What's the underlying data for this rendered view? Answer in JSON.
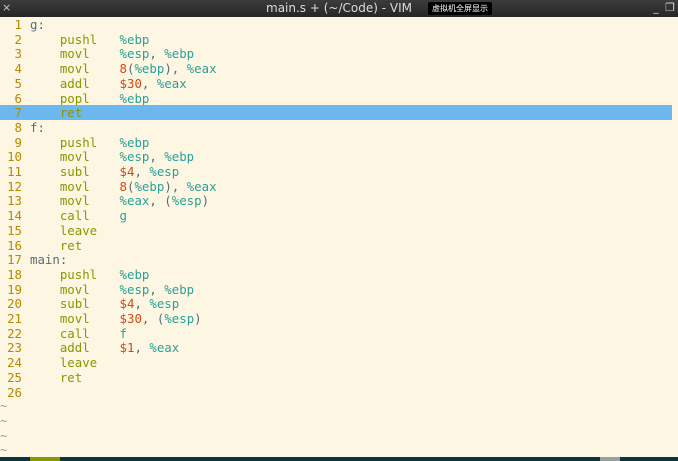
{
  "window": {
    "title": "main.s + (~/Code) - VIM",
    "badge": "虚拟机全屏显示",
    "close_glyph": "×",
    "minimize_glyph": "_",
    "restore_glyph": "❐"
  },
  "editor": {
    "highlighted_line": 7,
    "lines": [
      {
        "n": "1",
        "label": "g:",
        "ins": "",
        "ops": []
      },
      {
        "n": "2",
        "label": "",
        "ins": "pushl",
        "ops": [
          {
            "t": "reg",
            "v": "%ebp"
          }
        ]
      },
      {
        "n": "3",
        "label": "",
        "ins": "movl",
        "ops": [
          {
            "t": "reg",
            "v": "%esp"
          },
          {
            "t": "p",
            "v": ", "
          },
          {
            "t": "reg",
            "v": "%ebp"
          }
        ]
      },
      {
        "n": "4",
        "label": "",
        "ins": "movl",
        "ops": [
          {
            "t": "num",
            "v": "8"
          },
          {
            "t": "p",
            "v": "("
          },
          {
            "t": "reg",
            "v": "%ebp"
          },
          {
            "t": "p",
            "v": "), "
          },
          {
            "t": "reg",
            "v": "%eax"
          }
        ]
      },
      {
        "n": "5",
        "label": "",
        "ins": "addl",
        "ops": [
          {
            "t": "num",
            "v": "$30"
          },
          {
            "t": "p",
            "v": ", "
          },
          {
            "t": "reg",
            "v": "%eax"
          }
        ]
      },
      {
        "n": "6",
        "label": "",
        "ins": "popl",
        "ops": [
          {
            "t": "reg",
            "v": "%ebp"
          }
        ]
      },
      {
        "n": "7",
        "label": "",
        "ins": "ret",
        "ops": []
      },
      {
        "n": "8",
        "label": "f:",
        "ins": "",
        "ops": []
      },
      {
        "n": "9",
        "label": "",
        "ins": "pushl",
        "ops": [
          {
            "t": "reg",
            "v": "%ebp"
          }
        ]
      },
      {
        "n": "10",
        "label": "",
        "ins": "movl",
        "ops": [
          {
            "t": "reg",
            "v": "%esp"
          },
          {
            "t": "p",
            "v": ", "
          },
          {
            "t": "reg",
            "v": "%ebp"
          }
        ]
      },
      {
        "n": "11",
        "label": "",
        "ins": "subl",
        "ops": [
          {
            "t": "num",
            "v": "$4"
          },
          {
            "t": "p",
            "v": ", "
          },
          {
            "t": "reg",
            "v": "%esp"
          }
        ]
      },
      {
        "n": "12",
        "label": "",
        "ins": "movl",
        "ops": [
          {
            "t": "num",
            "v": "8"
          },
          {
            "t": "p",
            "v": "("
          },
          {
            "t": "reg",
            "v": "%ebp"
          },
          {
            "t": "p",
            "v": "), "
          },
          {
            "t": "reg",
            "v": "%eax"
          }
        ]
      },
      {
        "n": "13",
        "label": "",
        "ins": "movl",
        "ops": [
          {
            "t": "reg",
            "v": "%eax"
          },
          {
            "t": "p",
            "v": ", ("
          },
          {
            "t": "reg",
            "v": "%esp"
          },
          {
            "t": "p",
            "v": ")"
          }
        ]
      },
      {
        "n": "14",
        "label": "",
        "ins": "call",
        "ops": [
          {
            "t": "reg",
            "v": "g"
          }
        ]
      },
      {
        "n": "15",
        "label": "",
        "ins": "leave",
        "ops": []
      },
      {
        "n": "16",
        "label": "",
        "ins": "ret",
        "ops": []
      },
      {
        "n": "17",
        "label": "main:",
        "ins": "",
        "ops": []
      },
      {
        "n": "18",
        "label": "",
        "ins": "pushl",
        "ops": [
          {
            "t": "reg",
            "v": "%ebp"
          }
        ]
      },
      {
        "n": "19",
        "label": "",
        "ins": "movl",
        "ops": [
          {
            "t": "reg",
            "v": "%esp"
          },
          {
            "t": "p",
            "v": ", "
          },
          {
            "t": "reg",
            "v": "%ebp"
          }
        ]
      },
      {
        "n": "20",
        "label": "",
        "ins": "subl",
        "ops": [
          {
            "t": "num",
            "v": "$4"
          },
          {
            "t": "p",
            "v": ", "
          },
          {
            "t": "reg",
            "v": "%esp"
          }
        ]
      },
      {
        "n": "21",
        "label": "",
        "ins": "movl",
        "ops": [
          {
            "t": "num",
            "v": "$30"
          },
          {
            "t": "p",
            "v": ", ("
          },
          {
            "t": "reg",
            "v": "%esp"
          },
          {
            "t": "p",
            "v": ")"
          }
        ]
      },
      {
        "n": "22",
        "label": "",
        "ins": "call",
        "ops": [
          {
            "t": "reg",
            "v": "f"
          }
        ]
      },
      {
        "n": "23",
        "label": "",
        "ins": "addl",
        "ops": [
          {
            "t": "num",
            "v": "$1"
          },
          {
            "t": "p",
            "v": ", "
          },
          {
            "t": "reg",
            "v": "%eax"
          }
        ]
      },
      {
        "n": "24",
        "label": "",
        "ins": "leave",
        "ops": []
      },
      {
        "n": "25",
        "label": "",
        "ins": "ret",
        "ops": []
      },
      {
        "n": "26",
        "label": "",
        "ins": "",
        "ops": []
      }
    ],
    "tildes": [
      "~",
      "~",
      "~",
      "~"
    ]
  },
  "colors": {
    "background": "#fdf6e3",
    "line_number": "#b58900",
    "instruction": "#859900",
    "register": "#2aa198",
    "number": "#cb4b16",
    "cursorline": "#6cb8ee"
  }
}
